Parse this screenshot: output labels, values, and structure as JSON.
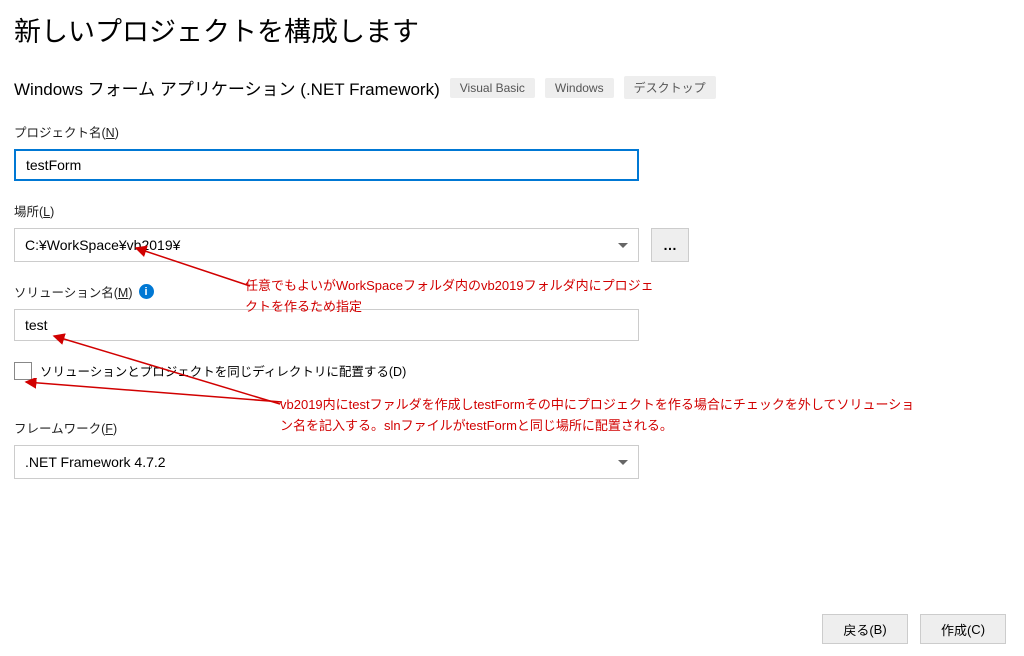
{
  "title": "新しいプロジェクトを構成します",
  "subtitle": "Windows フォーム アプリケーション (.NET Framework)",
  "tags": [
    "Visual Basic",
    "Windows",
    "デスクトップ"
  ],
  "fields": {
    "projectName": {
      "label": "プロジェクト名(",
      "hotkey": "N",
      "labelAfter": ")",
      "value": "testForm"
    },
    "location": {
      "label": "場所(",
      "hotkey": "L",
      "labelAfter": ")",
      "value": "C:¥WorkSpace¥vb2019¥",
      "browse": "…"
    },
    "solutionName": {
      "label": "ソリューション名(",
      "hotkey": "M",
      "labelAfter": ")",
      "value": "test",
      "info": "i"
    },
    "sameDir": {
      "label": "ソリューションとプロジェクトを同じディレクトリに配置する(",
      "hotkey": "D",
      "labelAfter": ")"
    },
    "framework": {
      "label": "フレームワーク(",
      "hotkey": "F",
      "labelAfter": ")",
      "value": ".NET Framework 4.7.2"
    }
  },
  "annotations": {
    "a1": "任意でもよいがWorkSpaceフォルダ内のvb2019フォルダ内にプロジェクトを作るため指定",
    "a2": "vb2019内にtestファルダを作成しtestFormその中にプロジェクトを作る場合にチェックを外してソリューション名を記入する。slnファイルがtestFormと同じ場所に配置される。"
  },
  "buttons": {
    "back": "戻る(",
    "backHotkey": "B",
    "backAfter": ")",
    "create": "作成(",
    "createHotkey": "C",
    "createAfter": ")"
  }
}
